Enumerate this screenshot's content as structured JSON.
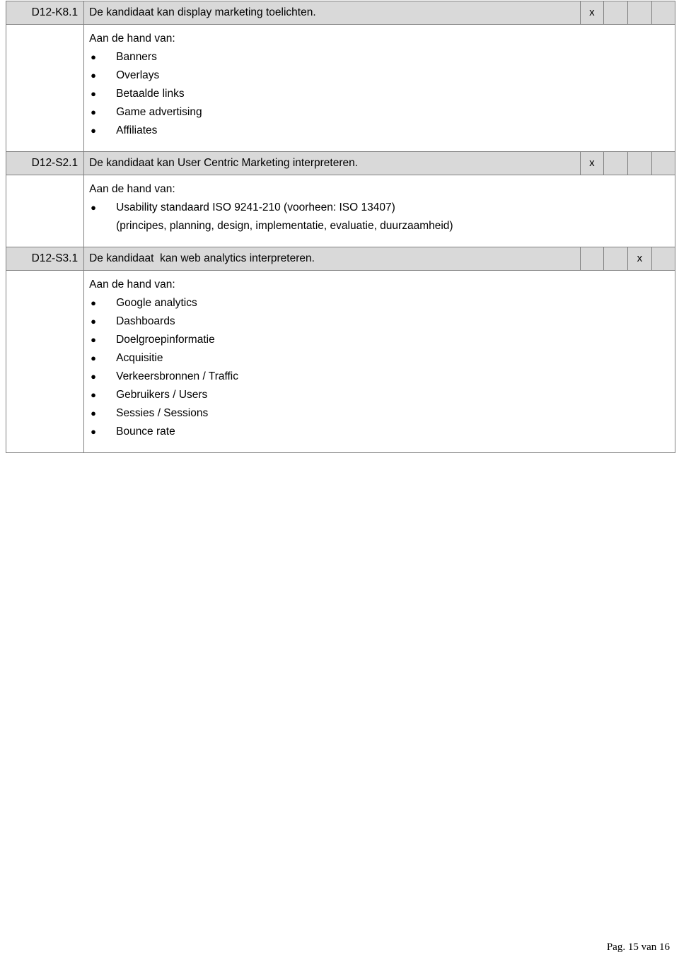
{
  "document": {
    "footer": "Pag. 15 van 16",
    "lead_label": "Aan de hand van:",
    "mark_symbol": "x",
    "column_count": 5
  },
  "table": {
    "sections": [
      {
        "code": "D12-K8.1",
        "title": "De kandidaat kan display marketing toelichten.",
        "marked_column": 1,
        "lead": "Aan de hand van:",
        "items": [
          {
            "text": "Banners"
          },
          {
            "text": "Overlays"
          },
          {
            "text": "Betaalde links"
          },
          {
            "text": "Game advertising"
          },
          {
            "text": "Affiliates"
          }
        ]
      },
      {
        "code": "D12-S2.1",
        "title": "De kandidaat kan User Centric Marketing interpreteren.",
        "marked_column": 1,
        "lead": "Aan de hand van:",
        "items": [
          {
            "text": "Usability standaard ISO 9241-210 (voorheen: ISO 13407)",
            "continuation": "(principes, planning, design, implementatie, evaluatie, duurzaamheid)"
          }
        ]
      },
      {
        "code": "D12-S3.1",
        "title": "De kandidaat  kan web analytics interpreteren.",
        "marked_column": 3,
        "lead": "Aan de hand van:",
        "items": [
          {
            "text": "Google analytics"
          },
          {
            "text": "Dashboards"
          },
          {
            "text": "Doelgroepinformatie"
          },
          {
            "text": "Acquisitie"
          },
          {
            "text": "Verkeersbronnen / Traffic"
          },
          {
            "text": "Gebruikers / Users"
          },
          {
            "text": "Sessies / Sessions"
          },
          {
            "text": "Bounce rate"
          }
        ]
      }
    ]
  }
}
